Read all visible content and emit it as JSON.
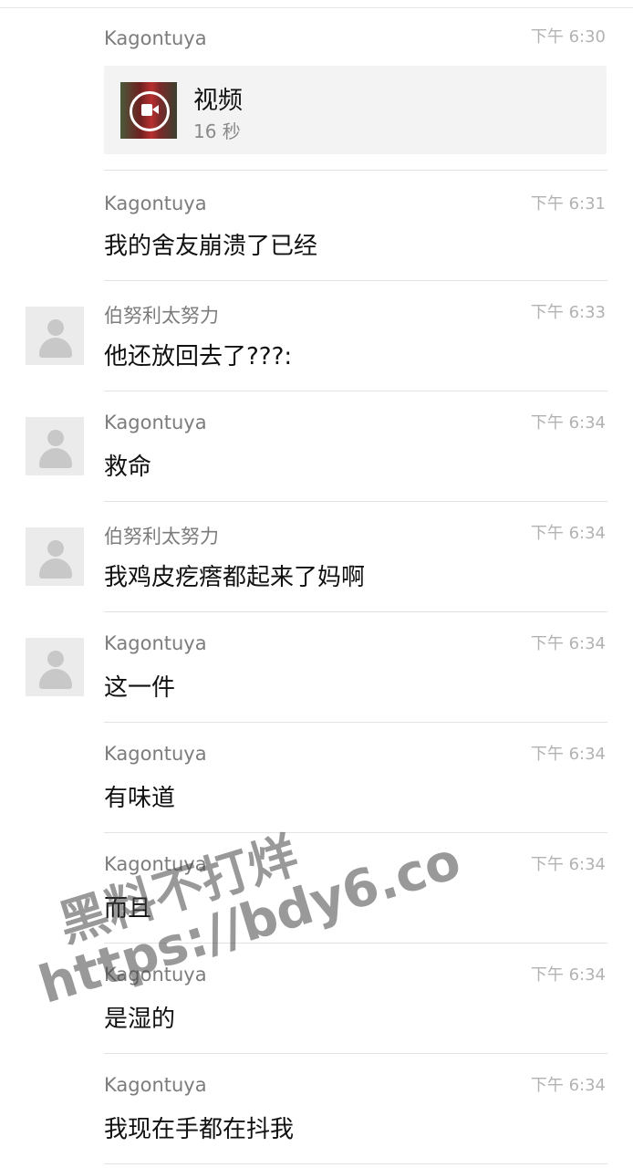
{
  "messages": [
    {
      "sender": "Kagontuya",
      "time": "下午 6:30",
      "video": {
        "title": "视频",
        "duration": "16 秒"
      },
      "avatar": false
    },
    {
      "sender": "Kagontuya",
      "time": "下午 6:31",
      "text": "我的舍友崩溃了已经",
      "avatar": false
    },
    {
      "sender": "伯努利太努力",
      "time": "下午 6:33",
      "text": "他还放回去了???:",
      "avatar": true
    },
    {
      "sender": "Kagontuya",
      "time": "下午 6:34",
      "text": "救命",
      "avatar": true
    },
    {
      "sender": "伯努利太努力",
      "time": "下午 6:34",
      "text": "我鸡皮疙瘩都起来了妈啊",
      "avatar": true
    },
    {
      "sender": "Kagontuya",
      "time": "下午 6:34",
      "text": "这一件",
      "avatar": true
    },
    {
      "sender": "Kagontuya",
      "time": "下午 6:34",
      "text": "有味道",
      "avatar": false
    },
    {
      "sender": "Kagontuya",
      "time": "下午 6:34",
      "text": "而且",
      "avatar": false
    },
    {
      "sender": "Kagontuya",
      "time": "下午 6:34",
      "text": "是湿的",
      "avatar": false
    },
    {
      "sender": "Kagontuya",
      "time": "下午 6:34",
      "text": "我现在手都在抖我",
      "avatar": false
    }
  ],
  "watermark": {
    "line1": "黑料不打烊",
    "line2": "https://bdy6.co"
  }
}
